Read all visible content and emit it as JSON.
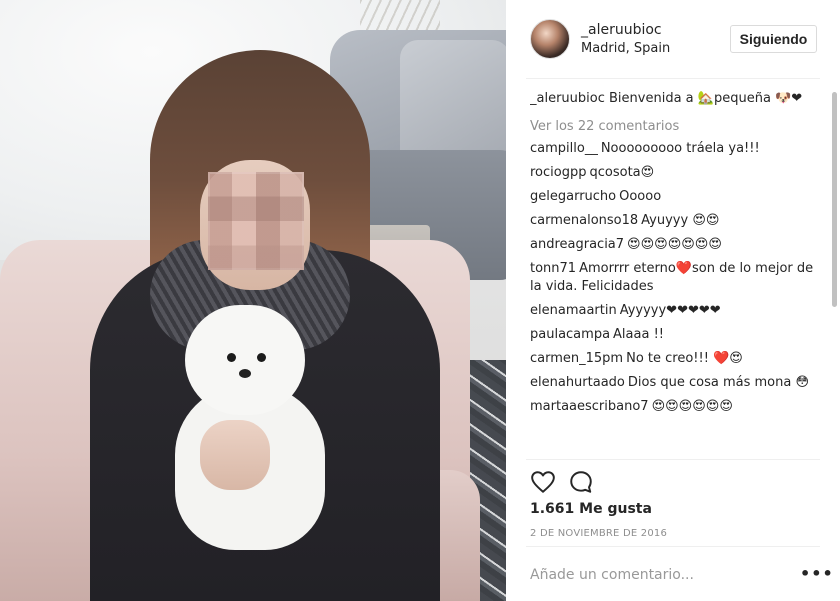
{
  "post": {
    "username": "_aleruubioc",
    "location": "Madrid, Spain",
    "follow_label": "Siguiendo",
    "caption_user": "_aleruubioc",
    "caption_text": "Bienvenida a 🏡pequeña 🐶❤",
    "view_all_comments": "Ver los 22 comentarios",
    "likes": "1.661 Me gusta",
    "date": "2 DE NOVIEMBRE DE 2016",
    "add_comment_placeholder": "Añade un comentario...",
    "more_options": "•••"
  },
  "comments": [
    {
      "user": "campillo__",
      "text": "Nooooooooo tráela ya!!!"
    },
    {
      "user": "rociogpp",
      "text": "qcosota😍"
    },
    {
      "user": "gelegarrucho",
      "text": "Ooooo"
    },
    {
      "user": "carmenalonso18",
      "text": "Ayuyyy 😍😍"
    },
    {
      "user": "andreagracia7",
      "text": "😍😍😍😍😍😍😍"
    },
    {
      "user": "tonn71",
      "text": "Amorrrr eterno❤️son de lo mejor de la vida. Felicidades"
    },
    {
      "user": "elenamaartin",
      "text": "Ayyyyy❤❤❤❤❤"
    },
    {
      "user": "paulacampa",
      "text": "Alaaa !!"
    },
    {
      "user": "carmen_15pm",
      "text": "No te creo!!! ❤️😍"
    },
    {
      "user": "elenahurtaado",
      "text": "Dios que cosa más mona 😳"
    },
    {
      "user": "martaaescribano7",
      "text": "😍😍😍😍😍😍"
    }
  ],
  "icons": {
    "like": "heart-icon",
    "comment": "comment-icon"
  },
  "colors": {
    "text": "#262626",
    "muted": "#8e8e8e",
    "border": "#dbdbdb"
  }
}
